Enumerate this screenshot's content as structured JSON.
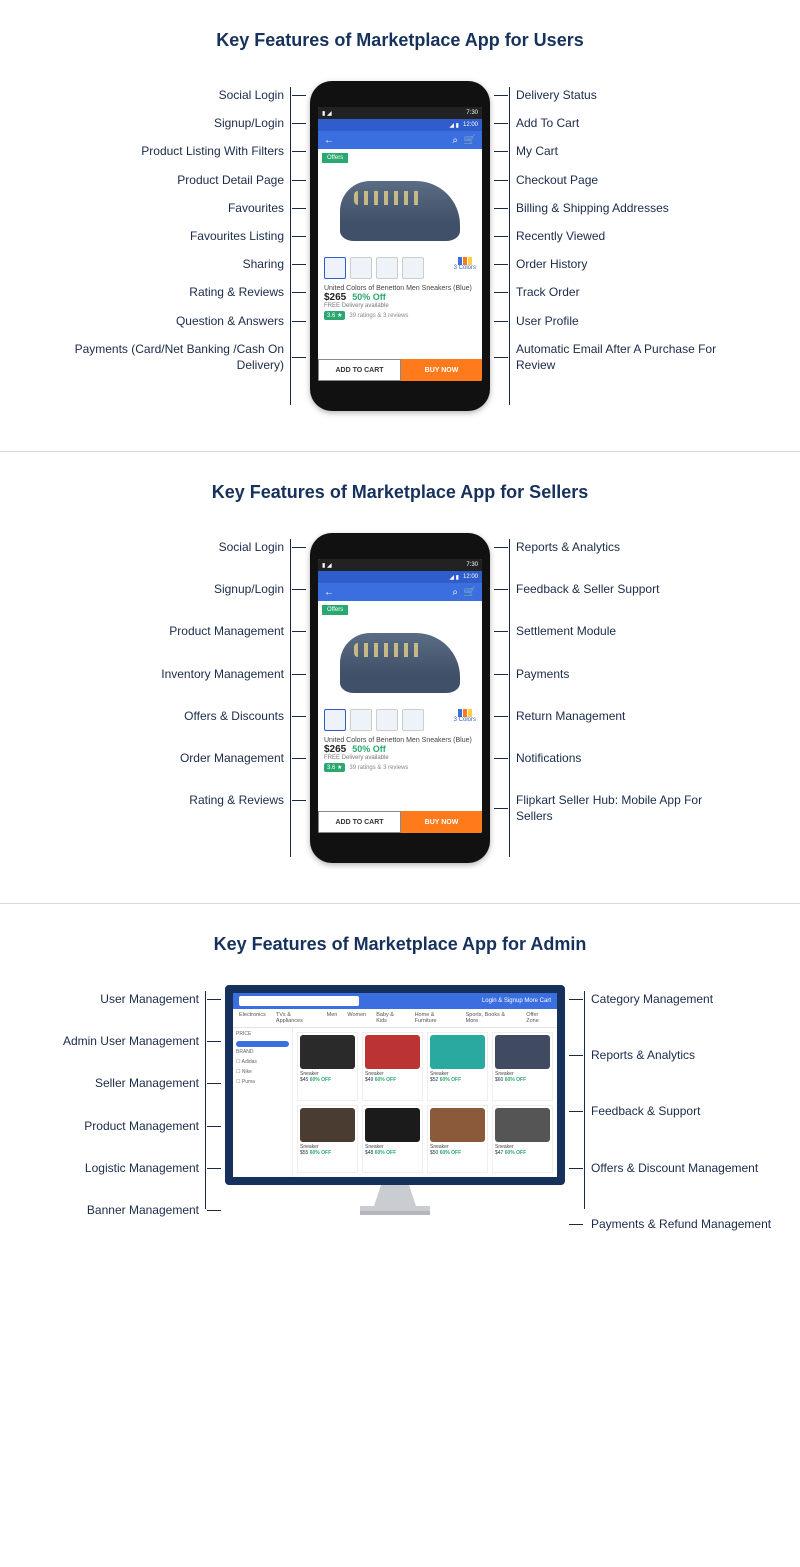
{
  "sections": {
    "users": {
      "title": "Key Features of Marketplace App for Users",
      "left": [
        "Social Login",
        "Signup/Login",
        "Product Listing With Filters",
        "Product Detail Page",
        "Favourites",
        "Favourites Listing",
        "Sharing",
        "Rating & Reviews",
        "Question & Answers",
        "Payments (Card/Net Banking /Cash On Delivery)"
      ],
      "right": [
        "Delivery Status",
        "Add To Cart",
        "My Cart",
        "Checkout Page",
        "Billing & Shipping Addresses",
        "Recently Viewed",
        "Order History",
        "Track Order",
        "User Profile",
        "Automatic Email After A Purchase For Review"
      ]
    },
    "sellers": {
      "title": "Key Features of Marketplace App for Sellers",
      "left": [
        "Social Login",
        "Signup/Login",
        "Product Management",
        "Inventory Management",
        "Offers & Discounts",
        "Order Management",
        "Rating & Reviews"
      ],
      "right": [
        "Reports & Analytics",
        "Feedback & Seller Support",
        "Settlement Module",
        "Payments",
        "Return Management",
        "Notifications",
        "Flipkart Seller Hub: Mobile App For Sellers"
      ]
    },
    "admin": {
      "title": "Key Features of Marketplace App for Admin",
      "left": [
        "User Management",
        "Admin User Management",
        "Seller Management",
        "Product Management",
        "Logistic Management",
        "Banner Management"
      ],
      "right": [
        "Category Management",
        "Reports & Analytics",
        "Feedback & Support",
        "Offers & Discount Management",
        "Payments & Refund Management"
      ]
    }
  },
  "phone_app": {
    "status_time": "7:30",
    "status2_time": "12:00",
    "offer_tag": "Offers",
    "product_title": "United Colors of Benetton Men Sneakers (Blue)",
    "price": "$265",
    "discount": "50% Off",
    "free_delivery": "FREE Delivery available",
    "rating": "3.6 ★",
    "rating_text": "39 ratings & 3 reviews",
    "colors_label": "3 Colors",
    "add_to_cart": "ADD TO CART",
    "buy_now": "BUY NOW"
  },
  "desktop_app": {
    "top_right": "Login & Signup    More    Cart",
    "tabs": [
      "Electronics",
      "TVs & Appliances",
      "Men",
      "Women",
      "Baby & Kids",
      "Home & Furniture",
      "Sports, Books & More",
      "Offer Zone"
    ],
    "sidebar": {
      "price": "PRICE",
      "brand": "BRAND"
    },
    "card_price_off": "60% OFF"
  }
}
